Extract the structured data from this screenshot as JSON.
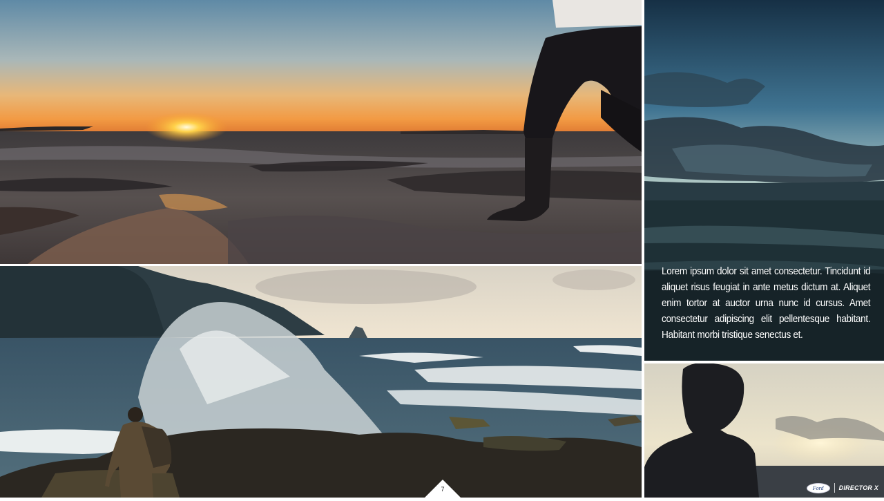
{
  "caption": {
    "text": "Lorem ipsum dolor sit amet consectetur. Tincidunt id aliquet risus feugiat in ante metus dictum at. Aliquet enim tortor at auctor urna nunc id cursus. Amet consectetur adipiscing elit pellentesque habitant. Habitant morbi tristique senectus et."
  },
  "page": {
    "number": "7"
  },
  "logos": {
    "brand": "Ford",
    "partner": "DIRECTOR X"
  },
  "colors": {
    "background": "#ffffff",
    "caption_text": "#ffffff",
    "sunset_glow": "#f7a233",
    "sky_top": "#1c3d57"
  }
}
